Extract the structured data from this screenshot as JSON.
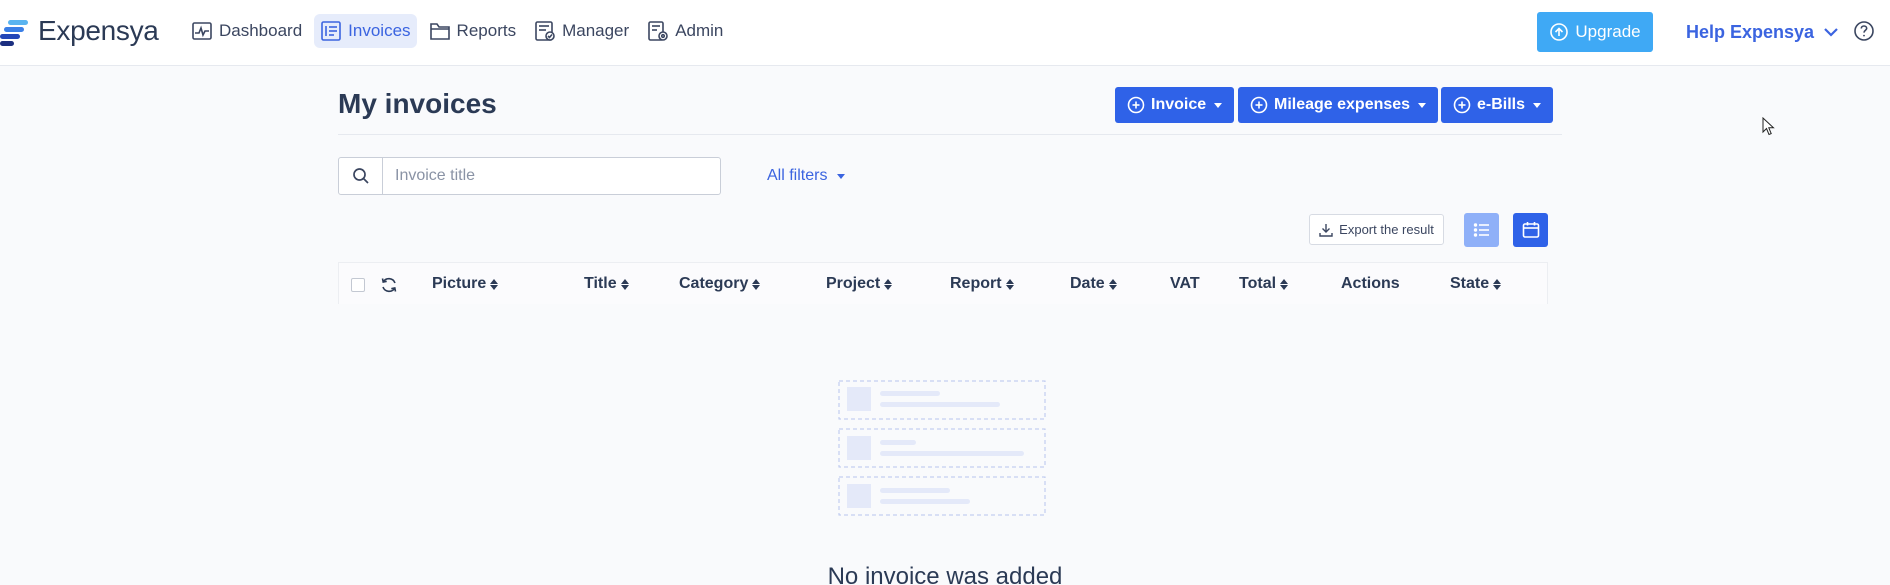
{
  "app": {
    "name": "Expensya",
    "brand_color": "#2f62e8",
    "upgrade_color": "#3fa9f5"
  },
  "nav": {
    "items": [
      {
        "label": "Dashboard",
        "icon": "chart-icon",
        "active": false
      },
      {
        "label": "Invoices",
        "icon": "invoice-icon",
        "active": true
      },
      {
        "label": "Reports",
        "icon": "folder-icon",
        "active": false
      },
      {
        "label": "Manager",
        "icon": "manager-icon",
        "active": false
      },
      {
        "label": "Admin",
        "icon": "admin-icon",
        "active": false
      }
    ],
    "upgrade_label": "Upgrade",
    "help_label": "Help Expensya"
  },
  "page": {
    "title": "My invoices",
    "actions": [
      {
        "label": "Invoice"
      },
      {
        "label": "Mileage expenses"
      },
      {
        "label": "e-Bills"
      }
    ]
  },
  "search": {
    "placeholder": "Invoice title",
    "value": ""
  },
  "filters": {
    "label": "All filters"
  },
  "toolbar": {
    "export_label": "Export the result",
    "view_mode": "list"
  },
  "table": {
    "columns": [
      "Picture",
      "Title",
      "Category",
      "Project",
      "Report",
      "Date",
      "VAT",
      "Total",
      "Actions",
      "State"
    ],
    "sortable": [
      true,
      true,
      true,
      true,
      true,
      true,
      false,
      true,
      false,
      true
    ],
    "rows": []
  },
  "empty_state": {
    "message": "No invoice was added"
  }
}
